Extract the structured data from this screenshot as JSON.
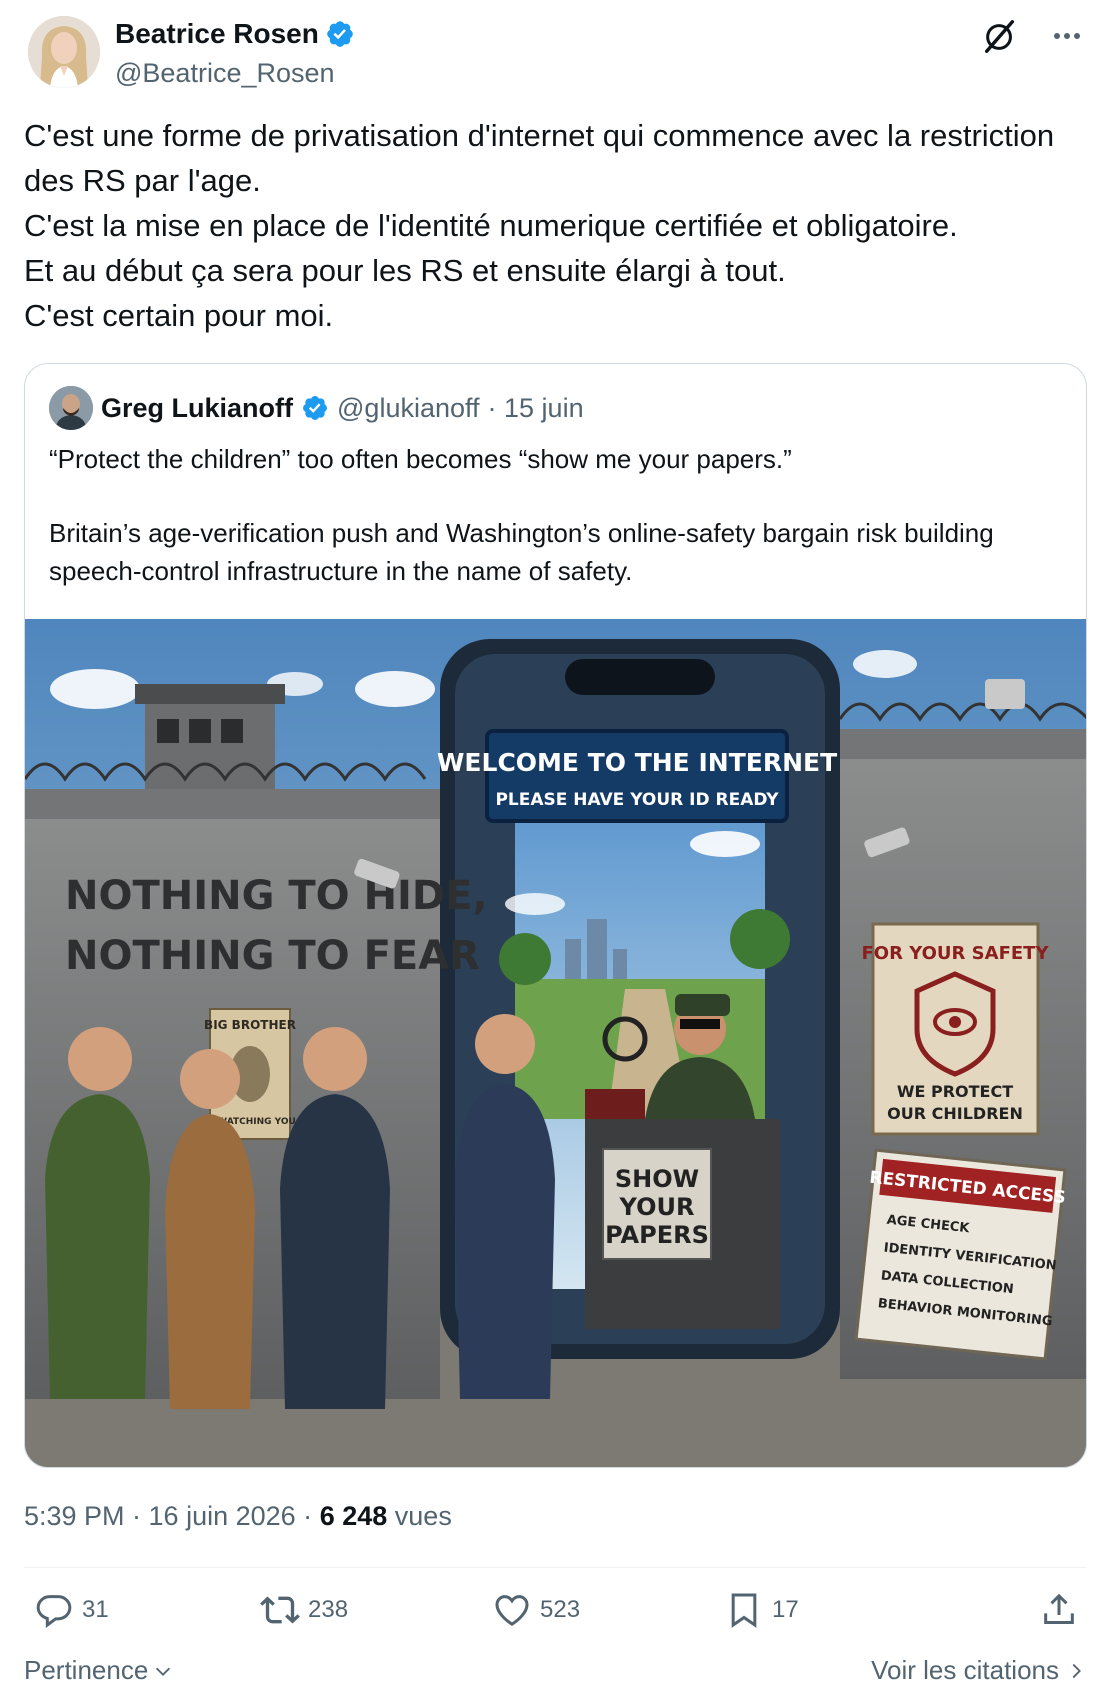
{
  "author": {
    "name": "Beatrice Rosen",
    "handle": "@Beatrice_Rosen"
  },
  "tweet": {
    "lines": [
      "C'est une forme de privatisation d'internet qui commence avec la restriction des RS par l'age.",
      "C'est la mise en place de l'identité numerique certifiée et obligatoire.",
      "Et au début ça sera pour les RS et ensuite élargi à tout.",
      "C'est certain pour moi."
    ]
  },
  "quote": {
    "name": "Greg Lukianoff",
    "handle": "@glukianoff",
    "date": "· 15 juin",
    "line1": "“Protect the children” too often becomes “show me your papers.”",
    "line2": "Britain’s age-verification push and Washington’s online-safety bargain risk building speech-control infrastructure in the name of safety.",
    "image": {
      "phone_title": "WELCOME TO THE INTERNET",
      "phone_subtitle": "PLEASE HAVE YOUR ID READY",
      "wall_text_1": "NOTHING TO HIDE,",
      "wall_text_2": "NOTHING TO FEAR",
      "poster_top": "BIG BROTHER",
      "poster_bottom": "IS WATCHING YOU",
      "desk_sign_1": "SHOW",
      "desk_sign_2": "YOUR",
      "desk_sign_3": "PAPERS",
      "safety_title": "FOR YOUR SAFETY",
      "safety_line1": "WE PROTECT",
      "safety_line2": "OUR CHILDREN",
      "restricted_title": "RESTRICTED ACCESS",
      "restricted_items": [
        "AGE CHECK",
        "IDENTITY VERIFICATION",
        "DATA COLLECTION",
        "BEHAVIOR MONITORING"
      ]
    }
  },
  "meta": {
    "time": "5:39 PM · 16 juin 2026 ·",
    "views_count": "6 248",
    "views_label": "vues"
  },
  "actions": {
    "replies": "31",
    "reposts": "238",
    "likes": "523",
    "bookmarks": "17"
  },
  "footer": {
    "sort_label": "Pertinence",
    "citations_label": "Voir les citations"
  },
  "colors": {
    "verified": "#1d9bf0",
    "text": "#0f1419",
    "muted": "#536471",
    "border": "#cfd9de"
  }
}
